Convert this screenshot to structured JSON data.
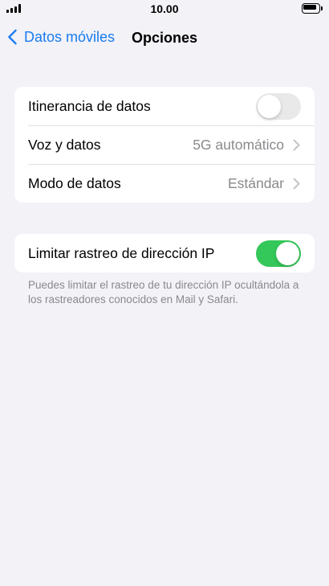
{
  "status_bar": {
    "time": "10.00"
  },
  "nav": {
    "back_label": "Datos móviles",
    "title": "Opciones"
  },
  "group1": {
    "roaming": {
      "label": "Itinerancia de datos",
      "enabled": false
    },
    "voice_data": {
      "label": "Voz y datos",
      "value": "5G automático"
    },
    "data_mode": {
      "label": "Modo de datos",
      "value": "Estándar"
    }
  },
  "group2": {
    "limit_ip": {
      "label": "Limitar rastreo de dirección IP",
      "enabled": true
    },
    "footer": "Puedes limitar el rastreo de tu dirección IP ocultándola a los rastreadores conocidos en Mail y Safari."
  },
  "colors": {
    "accent": "#1a7bf1",
    "toggle_on": "#34c759",
    "toggle_off": "#e9e9ea",
    "background": "#f2f2f7",
    "secondary_text": "#8a8a8e"
  }
}
